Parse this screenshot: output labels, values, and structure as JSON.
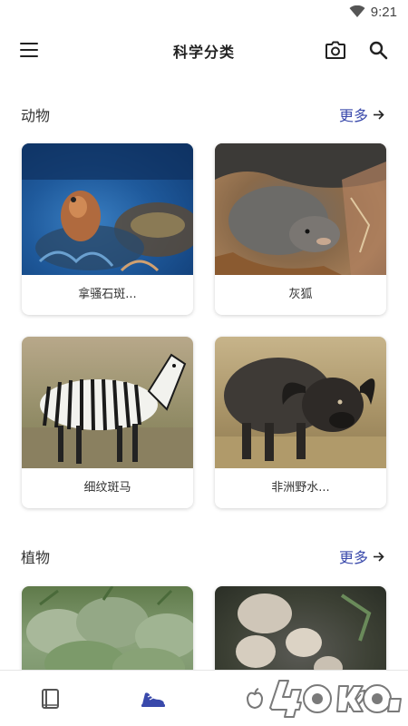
{
  "status_bar": {
    "time": "9:21"
  },
  "app_bar": {
    "title": "科学分类"
  },
  "sections": [
    {
      "title": "动物",
      "more_label": "更多",
      "cards": [
        {
          "label": "拿骚石斑..."
        },
        {
          "label": "灰狐"
        },
        {
          "label": "细纹斑马"
        },
        {
          "label": "非洲野水..."
        }
      ]
    },
    {
      "title": "植物",
      "more_label": "更多",
      "cards": []
    }
  ],
  "bottom_nav": {
    "items": [
      {
        "icon": "book-icon"
      },
      {
        "icon": "shoe-icon"
      },
      {
        "icon": "apple-icon"
      },
      {
        "icon": "leaf-icon"
      }
    ]
  },
  "watermark": {
    "text": "4G*O"
  },
  "colors": {
    "accent": "#3949ab",
    "text": "#333333"
  }
}
